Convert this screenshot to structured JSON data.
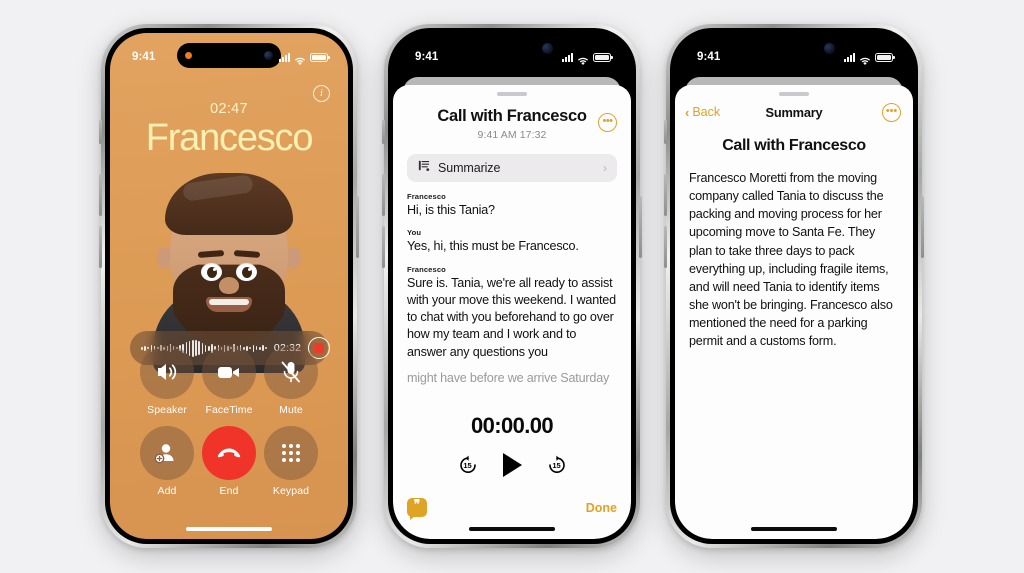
{
  "phone1": {
    "status": {
      "time": "9:41",
      "cell_icon": "cellular-bars-icon",
      "wifi_icon": "wifi-icon",
      "battery_icon": "battery-icon"
    },
    "info_button": "i",
    "call_duration": "02:47",
    "caller_name": "Francesco",
    "avatar": "memoji-avatar",
    "recording": {
      "elapsed": "02:32",
      "stop_label": "stop-recording",
      "waveform": [
        3,
        5,
        2,
        7,
        4,
        2,
        6,
        3,
        5,
        8,
        4,
        2,
        6,
        9,
        12,
        15,
        17,
        16,
        14,
        11,
        7,
        5,
        9,
        4,
        6,
        3,
        7,
        5,
        2,
        8,
        4,
        6,
        3,
        5,
        2,
        7,
        4,
        3,
        6,
        2
      ]
    },
    "controls": [
      {
        "label": "Speaker",
        "icon": "speaker-icon"
      },
      {
        "label": "FaceTime",
        "icon": "video-camera-icon"
      },
      {
        "label": "Mute",
        "icon": "microphone-muted-icon"
      },
      {
        "label": "Add",
        "icon": "add-person-icon"
      },
      {
        "label": "End",
        "icon": "end-call-icon"
      },
      {
        "label": "Keypad",
        "icon": "keypad-icon"
      }
    ]
  },
  "phone2": {
    "status": {
      "time": "9:41",
      "cell_icon": "cellular-bars-icon",
      "wifi_icon": "wifi-icon",
      "battery_icon": "battery-icon"
    },
    "title": "Call with Francesco",
    "subtitle": "9:41 AM  17:32",
    "more_button": "•••",
    "summarize": {
      "label": "Summarize",
      "icon": "summarize-icon",
      "chevron": "›"
    },
    "transcript": [
      {
        "speaker": "Francesco",
        "text": "Hi, is this Tania?",
        "faded": false
      },
      {
        "speaker": "You",
        "text": "Yes, hi, this must be Francesco.",
        "faded": false
      },
      {
        "speaker": "Francesco",
        "text": "Sure is. Tania, we're all ready to assist with your move this weekend. I wanted to chat with you beforehand to go over how my team and I work and to answer any questions you",
        "faded": false
      },
      {
        "speaker": "",
        "text": "might have before we arrive Saturday",
        "faded": true
      }
    ],
    "player": {
      "time": "00:00.00",
      "back_label": "15",
      "forward_label": "15",
      "play_icon": "play-icon",
      "back_icon": "skip-back-15-icon",
      "forward_icon": "skip-forward-15-icon"
    },
    "footer": {
      "badge_icon": "transcript-quote-icon",
      "badge_glyph": "❞",
      "done_label": "Done"
    }
  },
  "phone3": {
    "status": {
      "time": "9:41",
      "cell_icon": "cellular-bars-icon",
      "wifi_icon": "wifi-icon",
      "battery_icon": "battery-icon"
    },
    "nav": {
      "back_label": "Back",
      "back_chevron": "‹",
      "title": "Summary",
      "more_button": "•••"
    },
    "heading": "Call with Francesco",
    "body": "Francesco Moretti from the moving company called Tania to discuss the packing and moving process for her upcoming move to Santa Fe. They plan to take three days to pack everything up, including fragile items, and will need Tania to identify items she won't be bringing. Francesco also mentioned the need for a parking permit and a customs form."
  },
  "colors": {
    "page_background": "#f1f1f3",
    "call_screen": "#dd9c56",
    "caller_name": "#fbf0b3",
    "accent_gold": "#e0a325",
    "end_call_red": "#f0342a",
    "record_red": "#ec3b2b"
  }
}
